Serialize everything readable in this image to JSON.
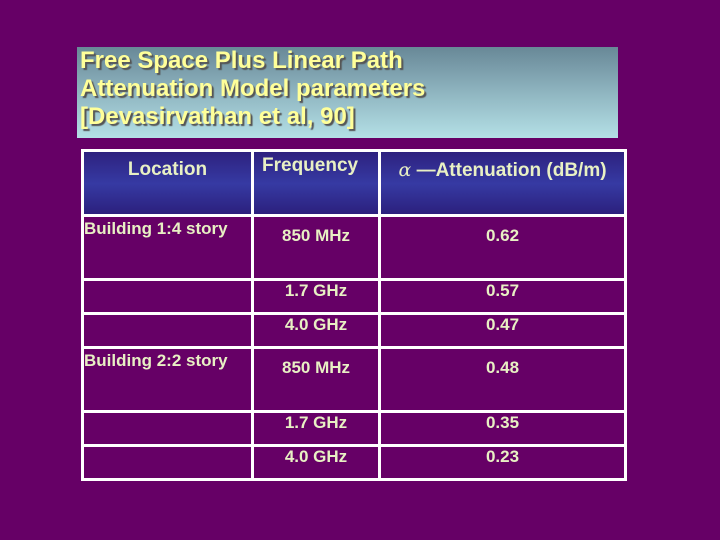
{
  "slide": {
    "title": "Free Space Plus Linear Path\nAttenuation Model parameters\n[Devasirvathan et al, 90]",
    "colors": {
      "background": "#660066",
      "title_text": "#ffff99",
      "body_text": "#e8f0c4",
      "header_fill": "#363aa3"
    }
  },
  "table": {
    "headers": {
      "location": "Location",
      "frequency": "Frequency",
      "attenuation_symbol": "α",
      "attenuation_label": "—Attenuation (dB/m)"
    },
    "rows": [
      {
        "location": "Building 1:4 story",
        "frequency": "850 MHz",
        "attenuation": "0.62"
      },
      {
        "location": "",
        "frequency": "1.7 GHz",
        "attenuation": "0.57"
      },
      {
        "location": "",
        "frequency": "4.0 GHz",
        "attenuation": "0.47"
      },
      {
        "location": "Building 2:2 story",
        "frequency": "850 MHz",
        "attenuation": "0.48"
      },
      {
        "location": "",
        "frequency": "1.7 GHz",
        "attenuation": "0.35"
      },
      {
        "location": "",
        "frequency": "4.0 GHz",
        "attenuation": "0.23"
      }
    ]
  }
}
